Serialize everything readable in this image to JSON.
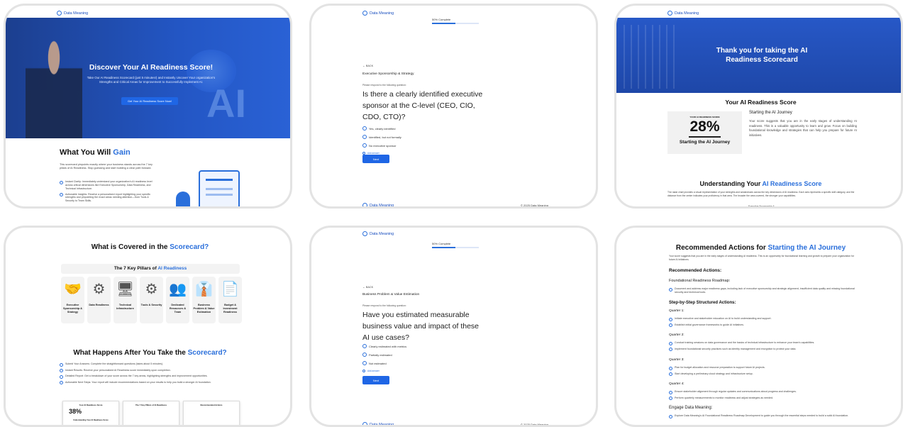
{
  "brand": "Data Meaning",
  "card1": {
    "hero_title": "Discover Your AI Readiness Score!",
    "hero_sub": "Take Our AI Readiness Scorecard (just 5 minutes!) and Instantly Uncover Your organization's Strengths and Critical Areas for Improvement to Successfully Implement AI.",
    "hero_btn": "Get Your AI Readiness Score Now!",
    "hero_ai": "AI",
    "gain_title": "What You Will",
    "gain_title_accent": "Gain",
    "gain_desc": "This scorecard pinpoints exactly where your business stands across the 7 key pillars of AI Readiness. Stop guessing and start building a clear path forward.",
    "b1": "Instant Clarity: Immediately understand your organization's AI readiness level across critical dimensions like Executive Sponsorship, Data Readiness, and Technical Infrastructure.",
    "b2": "Actionable Insights: Receive a personalized report highlighting your specific strengths and pinpointing the exact areas needing attention—from Tools & Security to Team Skills."
  },
  "card2": {
    "progress": "50% Complete",
    "progress_pct": 0.5,
    "back": "← BACK",
    "category": "Executive Sponsorship & Strategy",
    "prompt": "Please respond to the following question:",
    "question": "Is there a clearly identified executive sponsor at the C-level (CEO, CIO, CDO, CTO)?",
    "options": [
      "Yes, clearly identified",
      "Identified, but not formally",
      "No executive sponsor"
    ],
    "add": "Add answer",
    "next": "Next",
    "footer": "© 2025 Data Meaning"
  },
  "card3": {
    "hero": "Thank you for taking the AI Readiness Scorecard",
    "score_title": "Your AI Readiness Score",
    "score_label": "YOUR AI READINESS SCORE",
    "score": "28%",
    "level": "Starting the AI Journey",
    "journey_title": "Starting the AI Journey",
    "journey_text": "Your score suggests that you are in the early stages of understanding AI readiness. This is a valuable opportunity to learn and grow. Focus on building foundational knowledge and strategies that can help you prepare for future AI initiatives.",
    "under_title": "Understanding Your",
    "under_accent": "AI Readiness Score",
    "under_text": "The radar chart provides a visual representation of your strengths and weaknesses across the key dimensions of AI readiness. Each axis represents a specific skill category, and the distance from the center indicates your proficiency in that area. The broader the area covered, the stronger your capabilities.",
    "radar_label": "Executive Sponsorship &"
  },
  "card4": {
    "title": "What is Covered in the",
    "title_accent": "Scorecard?",
    "pillars_title": "The 7 Key Pillars of",
    "pillars_accent": "AI Readiness",
    "pillars": [
      "Executive Sponsorship & Strategy",
      "Data Readiness",
      "Technical Infrastructure",
      "Tools & Security",
      "Dedicated Resources & Team",
      "Business Problem & Value Estimation",
      "Budget & Investment Readiness"
    ],
    "after_title": "What Happens After You Take the",
    "after_accent": "Scorecard?",
    "steps": [
      "Submit Your Answers: Complete the straightforward questions (takes about 5 minutes).",
      "Instant Results: Receive your personalized AI Readiness score immediately upon completion.",
      "Detailed Report: Get a breakdown of your score across the 7 key areas, highlighting strengths and improvement opportunities.",
      "Actionable Next Steps: Your report will include recommendations based on your results to help you build a stronger AI foundation."
    ],
    "thumb1_title": "Your AI Readiness Score",
    "thumb1_score": "38%",
    "thumb1_under": "Understanding Your AI Readiness Score",
    "thumb2_title": "The 7 Key Pillars of AI Readiness",
    "thumb3_title": "Recommended Actions"
  },
  "card5": {
    "progress": "50% Complete",
    "progress_pct": 0.5,
    "back": "← BACK",
    "category": "Business Problem & Value Estimation",
    "prompt": "Please respond to the following question:",
    "question": "Have you estimated measurable business value and impact of these AI use cases?",
    "options": [
      "Clearly estimated with metrics",
      "Partially estimated",
      "Not estimated"
    ],
    "add": "Add answer",
    "next": "Next",
    "footer": "© 2025 Data Meaning"
  },
  "card6": {
    "title": "Recommended Actions for",
    "title_accent": "Starting the AI Journey",
    "intro": "Your score suggests that you are in the early stages of understanding AI readiness. This is an opportunity for foundational learning and growth to prepare your organization for future AI initiatives.",
    "rec": "Recommended Actions:",
    "roadmap": "Foundational Readiness Roadmap:",
    "roadmap_item": "Document and address major readiness gaps, including lack of executive sponsorship and strategic alignment, insufficient data quality and missing foundational security and technical tools.",
    "steps_title": "Step-by-Step Structured Actions:",
    "q1": "Quarter 1:",
    "q1a": "Initiate executive and stakeholder education on AI to build understanding and support.",
    "q1b": "Establish initial governance frameworks to guide AI initiatives.",
    "q2": "Quarter 2:",
    "q2a": "Conduct training sessions on data governance and the basics of technical infrastructure to enhance your team's capabilities.",
    "q2b": "Implement foundational security practices such as identity management and encryption to protect your data.",
    "q3": "Quarter 3:",
    "q3a": "Plan for budget allocation and resource preparation to support future AI projects.",
    "q3b": "Start developing a preliminary cloud strategy and infrastructure setup.",
    "q4": "Quarter 4:",
    "q4a": "Ensure stakeholder alignment through regular updates and communications about progress and challenges.",
    "q4b": "Perform quarterly measurements to monitor readiness and adjust strategies as needed.",
    "engage": "Engage Data Meaning:",
    "engage_item": "Explore Data Meaning's AI Foundational Readiness Roadmap Development to guide you through the essential steps needed to build a solid AI foundation."
  },
  "colors": {
    "accent": "#2a6fdb",
    "hero": "#1d4aa8"
  }
}
